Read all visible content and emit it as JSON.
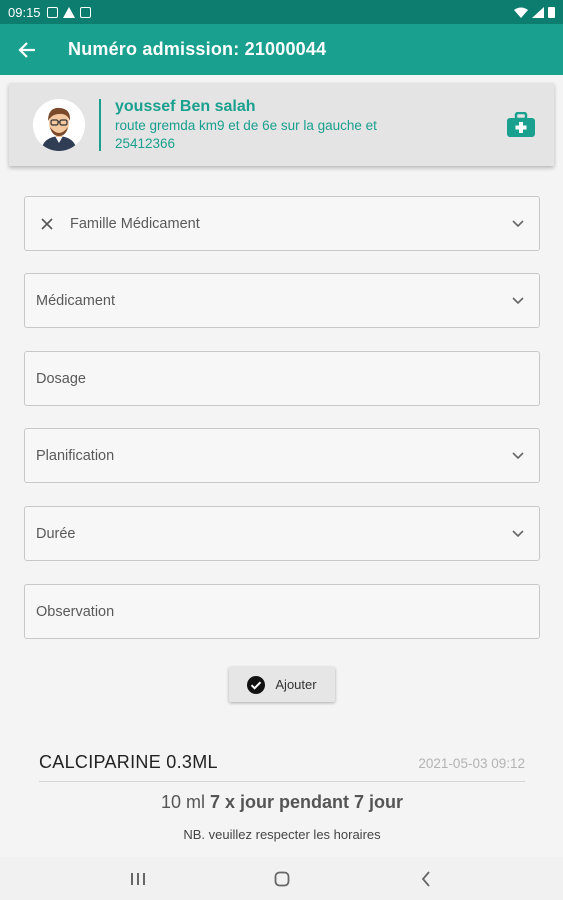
{
  "status_bar": {
    "time": "09:15"
  },
  "app_bar": {
    "title": "Numéro admission: 21000044"
  },
  "patient": {
    "name": "youssef Ben salah",
    "address": "route gremda km9 et de 6e sur la gauche et",
    "phone": "25412366"
  },
  "form": {
    "famille": "Famille Médicament",
    "medicament": "Médicament",
    "dosage": "Dosage",
    "planification": "Planification",
    "duree": "Durée",
    "observation": "Observation",
    "add_label": "Ajouter"
  },
  "prescription": {
    "name": "CALCIPARINE 0.3ML",
    "date": "2021-05-03 09:12",
    "dose_amount": "10 ml",
    "dose_frequency": "7 x jour pendant 7 jour",
    "note": "NB. veuillez respecter les horaires"
  },
  "colors": {
    "primary": "#1aa08e",
    "primary_dark": "#0d7d6f"
  }
}
